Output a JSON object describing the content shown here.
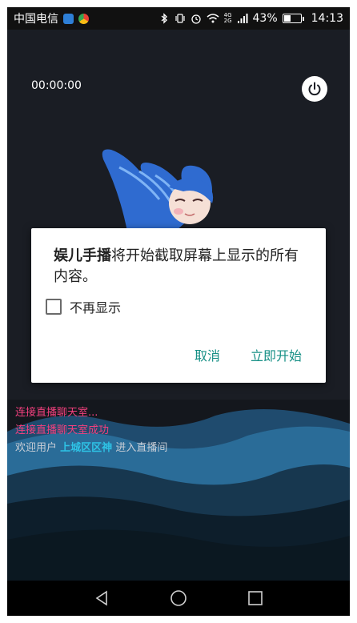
{
  "status_bar": {
    "carrier": "中国电信",
    "network": "4G",
    "network_sub": "2G",
    "battery": "43%",
    "battery_level": 0.43,
    "time": "14:13",
    "icons": [
      "bluetooth-icon",
      "vibrate-icon",
      "alarm-icon",
      "wifi-icon",
      "signal-icon",
      "battery-icon"
    ]
  },
  "stream": {
    "timer": "00:00:00"
  },
  "dialog": {
    "app_name": "娱儿手播",
    "message": "将开始截取屏幕上显示的所有内容。",
    "checkbox_label": "不再显示",
    "checkbox_checked": false,
    "cancel_label": "取消",
    "start_label": "立即开始"
  },
  "chat": {
    "messages": [
      {
        "text": "连接直播聊天室..."
      },
      {
        "text": "连接直播聊天室成功"
      }
    ],
    "welcome": {
      "prefix": "欢迎用户",
      "user": "上城区区神",
      "suffix": "进入直播间"
    }
  },
  "colors": {
    "accent": "#158f85",
    "chat_pink": "#f2407e",
    "chat_user": "#2ec3e6",
    "background": "#1a1d24"
  }
}
